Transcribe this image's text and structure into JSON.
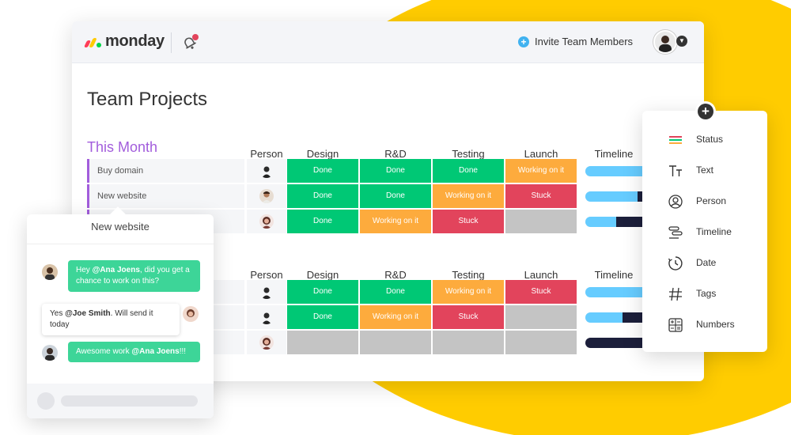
{
  "app": {
    "logo_text": "monday",
    "invite_label": "Invite Team Members",
    "page_title": "Team Projects"
  },
  "colors": {
    "done": "#00c875",
    "working": "#fdab3d",
    "stuck": "#e2445c",
    "empty": "#c4c4c4",
    "group": "#a25ddc",
    "timeline_light": "#66ccff",
    "timeline_dark": "#1c1f3b",
    "accent_yellow": "#ffcc00"
  },
  "columns": [
    "Person",
    "Design",
    "R&D",
    "Testing",
    "Launch",
    "Timeline"
  ],
  "groups": [
    {
      "title": "This Month",
      "rows": [
        {
          "name": "Buy domain",
          "person": "man-dark",
          "cells": [
            "Done",
            "Done",
            "Done",
            "Working on it"
          ],
          "states": [
            "done",
            "done",
            "done",
            "working"
          ],
          "timeline": {
            "light": 0.95,
            "dark": 0.0
          }
        },
        {
          "name": "New website",
          "person": "man-beard",
          "cells": [
            "Done",
            "Done",
            "Working on it",
            "Stuck"
          ],
          "states": [
            "done",
            "done",
            "working",
            "stuck"
          ],
          "timeline": {
            "light": 0.85,
            "dark": 0.15
          }
        },
        {
          "name": "",
          "person": "woman",
          "cells": [
            "Done",
            "Working on it",
            "Stuck",
            ""
          ],
          "states": [
            "done",
            "working",
            "stuck",
            "empty"
          ],
          "timeline": {
            "light": 0.5,
            "dark": 0.5
          }
        }
      ]
    },
    {
      "title": "",
      "rows": [
        {
          "name": "",
          "person": "man-dark",
          "cells": [
            "Done",
            "Done",
            "Working on it",
            "Stuck"
          ],
          "states": [
            "done",
            "done",
            "working",
            "stuck"
          ],
          "timeline": {
            "light": 0.95,
            "dark": 0.0
          }
        },
        {
          "name": "",
          "person": "man-dark",
          "cells": [
            "Done",
            "Working on it",
            "Stuck",
            ""
          ],
          "states": [
            "done",
            "working",
            "stuck",
            "empty"
          ],
          "timeline": {
            "light": 0.6,
            "dark": 0.4
          }
        },
        {
          "name": "",
          "person": "woman",
          "cells": [
            "",
            "",
            "",
            ""
          ],
          "states": [
            "empty",
            "empty",
            "empty",
            "empty"
          ],
          "timeline": {
            "light": 0.0,
            "dark": 1.0
          }
        }
      ]
    }
  ],
  "chat": {
    "title": "New website",
    "messages": [
      {
        "side": "left",
        "style": "green",
        "pre": "Hey ",
        "mention": "@Ana Joens",
        "post": ", did you get a chance to work on this?"
      },
      {
        "side": "right",
        "style": "white",
        "pre": "Yes ",
        "mention": "@Joe Smith",
        "post": ". Will send it today"
      },
      {
        "side": "left",
        "style": "green",
        "pre": "Awesome work ",
        "mention": "@Ana Joens",
        "post": "!!!"
      }
    ]
  },
  "picker": {
    "items": [
      {
        "label": "Status",
        "icon": "status-icon"
      },
      {
        "label": "Text",
        "icon": "text-icon"
      },
      {
        "label": "Person",
        "icon": "person-icon"
      },
      {
        "label": "Timeline",
        "icon": "timeline-icon"
      },
      {
        "label": "Date",
        "icon": "date-icon"
      },
      {
        "label": "Tags",
        "icon": "tags-icon"
      },
      {
        "label": "Numbers",
        "icon": "numbers-icon"
      }
    ]
  }
}
